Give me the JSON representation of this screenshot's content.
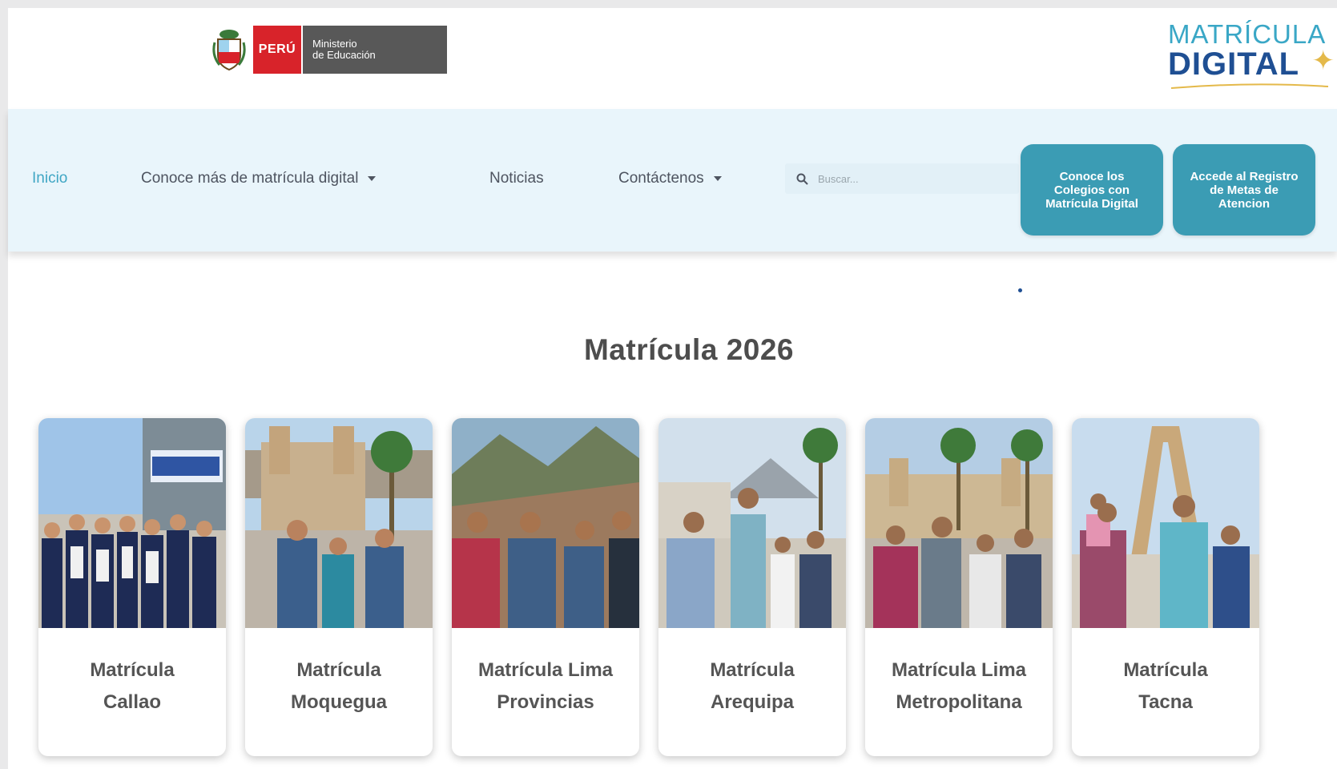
{
  "header": {
    "gov": {
      "country": "PERÚ",
      "ministry_line1": "Ministerio",
      "ministry_line2": "de Educación"
    },
    "brand": {
      "line1": "MATRÍCULA",
      "line2": "DIGITAL"
    }
  },
  "nav": {
    "items": [
      {
        "label": "Inicio",
        "active": true,
        "dropdown": false
      },
      {
        "label": "Conoce más de matrícula digital",
        "active": false,
        "dropdown": true
      },
      {
        "label": "Noticias",
        "active": false,
        "dropdown": false
      },
      {
        "label": "Contáctenos",
        "active": false,
        "dropdown": true
      }
    ],
    "search_placeholder": "Buscar...",
    "cta": [
      {
        "label": "Conoce los Colegios con Matrícula Digital"
      },
      {
        "label": "Accede al Registro de Metas de Atencion"
      }
    ]
  },
  "main": {
    "title": "Matrícula 2026",
    "cards": [
      {
        "line1": "Matrícula",
        "line2": "Callao",
        "scene": "students-school-building"
      },
      {
        "line1": "Matrícula",
        "line2": "Moquegua",
        "scene": "family-cathedral-palm"
      },
      {
        "line1": "Matrícula Lima",
        "line2": "Provincias",
        "scene": "family-andean-mountains"
      },
      {
        "line1": "Matrícula",
        "line2": "Arequipa",
        "scene": "family-plaza-volcano"
      },
      {
        "line1": "Matrícula Lima",
        "line2": "Metropolitana",
        "scene": "family-lima-cathedral"
      },
      {
        "line1": "Matrícula",
        "line2": "Tacna",
        "scene": "family-tacna-arch"
      }
    ]
  },
  "colors": {
    "nav_bg": "#e9f5fb",
    "accent": "#3fa6c4",
    "cta_bg": "#3b9cb4",
    "peru_red": "#d8232a",
    "brand_blue": "#1f4f93"
  }
}
